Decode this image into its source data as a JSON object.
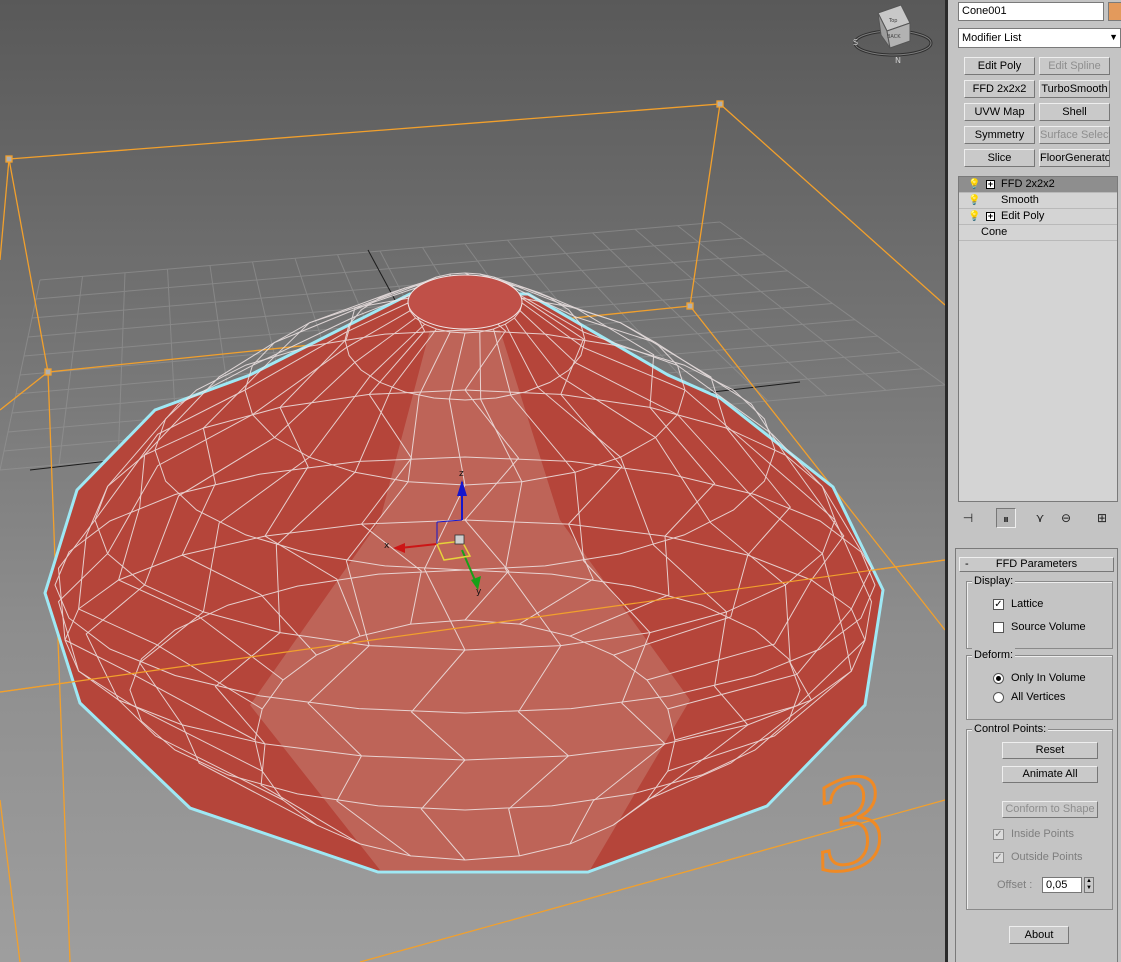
{
  "viewport": {
    "viewcube": {
      "face_top": "Top",
      "face_label": "BACK",
      "compass_w": "S",
      "compass_n": "N"
    },
    "axis_labels": {
      "x": "x",
      "y": "y",
      "z": "z"
    },
    "annotation": "3",
    "colors": {
      "mesh": "#b5453a",
      "wire": "#f0e6e6",
      "lattice": "#f2a02c",
      "outline": "#9fe8f4",
      "annotation": "#f08a24"
    }
  },
  "panel": {
    "object_name": "Cone001",
    "modifier_list": "Modifier List",
    "modifier_buttons": [
      {
        "label": "Edit Poly",
        "disabled": false
      },
      {
        "label": "Edit Spline",
        "disabled": true
      },
      {
        "label": "FFD 2x2x2",
        "disabled": false
      },
      {
        "label": "TurboSmooth",
        "disabled": false
      },
      {
        "label": "UVW Map",
        "disabled": false
      },
      {
        "label": "Shell",
        "disabled": false
      },
      {
        "label": "Symmetry",
        "disabled": false
      },
      {
        "label": "Surface Select",
        "disabled": true
      },
      {
        "label": "Slice",
        "disabled": false
      },
      {
        "label": "FloorGenerator",
        "disabled": false
      }
    ],
    "stack": [
      {
        "label": "FFD 2x2x2",
        "selected": true
      },
      {
        "label": "Smooth",
        "selected": false
      },
      {
        "label": "Edit Poly",
        "selected": false
      },
      {
        "label": "Cone",
        "selected": false
      }
    ],
    "ffd": {
      "title": "FFD Parameters",
      "display": {
        "title": "Display:",
        "lattice": "Lattice",
        "source_volume": "Source Volume"
      },
      "deform": {
        "title": "Deform:",
        "only_in_volume": "Only In Volume",
        "all_vertices": "All Vertices"
      },
      "control_points": {
        "title": "Control Points:",
        "reset": "Reset",
        "animate_all": "Animate All",
        "conform": "Conform to Shape",
        "inside_points": "Inside Points",
        "outside_points": "Outside Points",
        "offset_label": "Offset :",
        "offset_value": "0,05"
      },
      "about": "About"
    }
  }
}
